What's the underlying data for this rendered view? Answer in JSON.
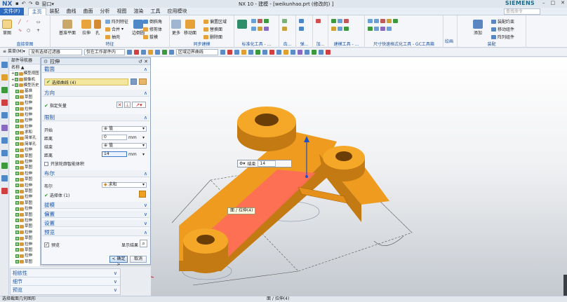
{
  "titlebar": {
    "logo": "NX",
    "window_menu": "窗口",
    "title": "NX 10 - 建模 - [weikunhao.prt  (修改的) ]",
    "brand": "SIEMENS"
  },
  "menu": {
    "file": "文件(F)",
    "tabs": [
      "主页",
      "装配",
      "曲线",
      "曲面",
      "分析",
      "视图",
      "渲染",
      "工具",
      "应用模块"
    ],
    "active_tab": "主页",
    "search_placeholder": "查找命令"
  },
  "ribbon": {
    "groups": [
      {
        "label": "直接草图",
        "buttons": [
          "草图"
        ]
      },
      {
        "label": "特征",
        "buttons": [
          "基准平面",
          "拉伸",
          "孔"
        ],
        "small": [
          "阵列特征",
          "合并",
          "抽壳",
          "倒斜角",
          "修剪体",
          "拔模"
        ]
      },
      {
        "label": "同步建模",
        "buttons": [
          "边倒圆",
          "移动面",
          "更多"
        ],
        "small": [
          "偏置区域",
          "替换面",
          "删除面"
        ]
      },
      {
        "label": "标准化工具 - ...",
        "buttons": []
      },
      {
        "label": "齿...",
        "buttons": []
      },
      {
        "label": "弹...",
        "buttons": []
      },
      {
        "label": "加...",
        "buttons": []
      },
      {
        "label": "建模工具 - ...",
        "buttons": []
      },
      {
        "label": "尺寸快速格式化工具 - GC工具箱",
        "buttons": []
      },
      {
        "label": "装配",
        "buttons": [
          "添加"
        ],
        "small": [
          "装配约束",
          "移动组件",
          "阵列组件"
        ]
      }
    ],
    "more_label": "更多",
    "draw_label": "绘画"
  },
  "selection_bar": {
    "menu": "菜单(M)",
    "filter": "没有选择过滤器",
    "scope": "仅在工作部件内",
    "curve_rule": "区域边界曲线"
  },
  "navigator": {
    "title": "部件导航器",
    "column": "名称",
    "rows": [
      "模型视图",
      "摄像机",
      "模型历史",
      "基准",
      "草图",
      "拉伸",
      "拉伸",
      "拉伸",
      "拉伸",
      "拉伸",
      "求和",
      "简单孔",
      "简单孔",
      "拉伸",
      "草图",
      "拉伸",
      "草图",
      "拉伸",
      "草图",
      "拉伸",
      "草图",
      "拉伸",
      "草图",
      "拉伸",
      "草图",
      "拉伸",
      "草图",
      "拉伸",
      "草图",
      "拉伸",
      "草图",
      "拉伸",
      "草图"
    ]
  },
  "dialog": {
    "title": "拉伸",
    "section": {
      "title": "截面",
      "select_curve": "选择曲线 (4)"
    },
    "direction": {
      "title": "方向",
      "specify_vector": "指定矢量"
    },
    "limits": {
      "title": "限制",
      "start_label": "开始",
      "start_option": "值",
      "start_distance_label": "距离",
      "start_distance": "0",
      "end_label": "结束",
      "end_option": "值",
      "end_distance_label": "距离",
      "end_distance": "14",
      "unit": "mm",
      "open_profile": "开放轮廓智能体积"
    },
    "boolean": {
      "title": "布尔",
      "label": "布尔",
      "option": "求和",
      "select_body": "选择体 (1)"
    },
    "draft": "拔模",
    "offset": "偏置",
    "settings": "设置",
    "preview": {
      "title": "预览",
      "checkbox": "预览",
      "show_result": "显示结果"
    },
    "ok": "< 确定 >",
    "cancel": "取消"
  },
  "lower_sections": [
    "相依性",
    "细节",
    "预览"
  ],
  "viewport": {
    "end_label": "结束",
    "end_value": "14",
    "tooltip": "面 / 拉伸(4)"
  },
  "status": {
    "left": "选择截面几何图形",
    "center": "面 / 拉伸(4)"
  },
  "colors": {
    "part": "#f0a020",
    "part_dark": "#c27a10",
    "preview": "#ff6b5a",
    "accent": "#1e58ad"
  }
}
